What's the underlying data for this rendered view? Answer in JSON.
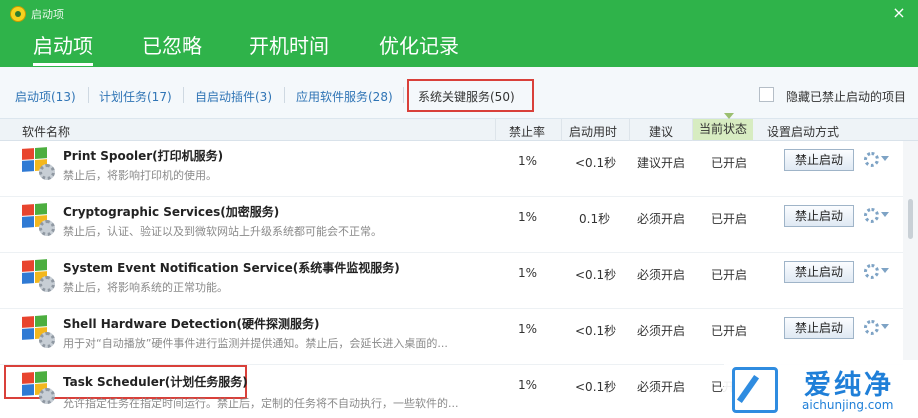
{
  "window": {
    "title": "启动项",
    "close_symbol": "×"
  },
  "main_tabs": [
    {
      "label": "启动项",
      "active": true
    },
    {
      "label": "已忽略",
      "active": false
    },
    {
      "label": "开机时间",
      "active": false
    },
    {
      "label": "优化记录",
      "active": false
    }
  ],
  "sub_tabs": [
    {
      "label": "启动项(13)"
    },
    {
      "label": "计划任务(17)"
    },
    {
      "label": "自启动插件(3)"
    },
    {
      "label": "应用软件服务(28)"
    },
    {
      "label": "系统关键服务(50)",
      "active": true
    }
  ],
  "hide_disabled_label": "隐藏已禁止启动的项目",
  "columns": {
    "name": "软件名称",
    "disable_rate": "禁止率",
    "boot_time": "启动用时",
    "advice": "建议",
    "state": "当前状态",
    "set_method": "设置启动方式"
  },
  "rows": [
    {
      "name": "Print Spooler(打印机服务)",
      "desc": "禁止后，将影响打印机的使用。",
      "rate": "1%",
      "time": "<0.1秒",
      "advice": "建议开启",
      "state": "已开启",
      "action": "禁止启动"
    },
    {
      "name": "Cryptographic Services(加密服务)",
      "desc": "禁止后，认证、验证以及到微软网站上升级系统都可能会不正常。",
      "rate": "1%",
      "time": "0.1秒",
      "advice": "必须开启",
      "state": "已开启",
      "action": "禁止启动"
    },
    {
      "name": "System Event Notification Service(系统事件监视服务)",
      "desc": "禁止后，将影响系统的正常功能。",
      "rate": "1%",
      "time": "<0.1秒",
      "advice": "必须开启",
      "state": "已开启",
      "action": "禁止启动"
    },
    {
      "name": "Shell Hardware Detection(硬件探测服务)",
      "desc": "用于对“自动播放”硬件事件进行监测并提供通知。禁止后，会延长进入桌面的...",
      "rate": "1%",
      "time": "<0.1秒",
      "advice": "必须开启",
      "state": "已开启",
      "action": "禁止启动"
    },
    {
      "name": "Task Scheduler(计划任务服务)",
      "desc": "允许指定任务在指定时间运行。禁止后，定制的任务将不自动执行，一些软件的...",
      "rate": "1%",
      "time": "<0.1秒",
      "advice": "必须开启",
      "state": "已开",
      "action": ""
    }
  ],
  "watermark": {
    "cn": "爱纯净",
    "en": "aichunjing.com"
  },
  "colors": {
    "header_green": "#2fb34a",
    "link_blue": "#2f74b5",
    "highlight_red": "#d9403a"
  }
}
